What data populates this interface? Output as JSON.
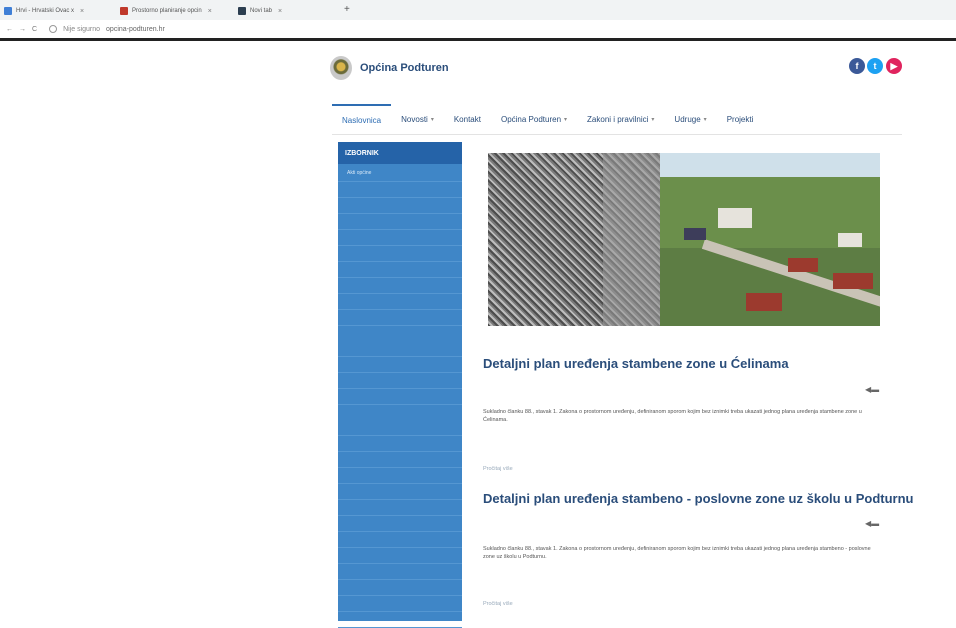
{
  "browser": {
    "tabs": [
      {
        "label": "Hrvi - Hrvatski Ovac x",
        "color": "#3f7fd6"
      },
      {
        "label": "Prostorno planiranje opcin",
        "color": "#c0392b"
      },
      {
        "label": "Novi tab",
        "color": "#2c3e50"
      }
    ],
    "new_tab": "+",
    "url_prefix": "Nije sigurno",
    "url": "opcina-podturen.hr"
  },
  "site": {
    "name": "Općina Podturen",
    "social": {
      "facebook": "f",
      "twitter": "t",
      "youtube": "▶"
    }
  },
  "nav": [
    {
      "label": "Naslovnica",
      "active": true,
      "dropdown": false
    },
    {
      "label": "Novosti",
      "active": false,
      "dropdown": true
    },
    {
      "label": "Kontakt",
      "active": false,
      "dropdown": false
    },
    {
      "label": "Općina Podturen",
      "active": false,
      "dropdown": true
    },
    {
      "label": "Zakoni i pravilnici",
      "active": false,
      "dropdown": true
    },
    {
      "label": "Udruge",
      "active": false,
      "dropdown": true
    },
    {
      "label": "Projekti",
      "active": false,
      "dropdown": false
    }
  ],
  "sidebar": {
    "title": "IZBORNIK",
    "items": [
      "Akti općine"
    ]
  },
  "posts": [
    {
      "title": "Detaljni plan uređenja stambene zone u Ćelinama",
      "excerpt": "Sukladno članku 88., stavak 1. Zakona o prostornom uređenju, definiranom sporom kojim bez iznimki treba ukazati jednog plana uređenja stambene zone u Ćelinama.",
      "readmore": "Pročitaj više"
    },
    {
      "title": "Detaljni plan uređenja stambeno - poslovne zone uz školu u Podturnu",
      "excerpt": "Sukladno članku 88., stavak 1. Zakona o prostornom uređenju, definiranom sporom kojim bez iznimki treba ukazati jednog plana uređenja stambeno - poslovne zone uz školu u Podturnu.",
      "readmore": "Pročitaj više"
    }
  ],
  "colors": {
    "brand": "#2a4d7a",
    "sidebar_bg": "#3f86c7",
    "sidebar_head": "#2563a8"
  }
}
